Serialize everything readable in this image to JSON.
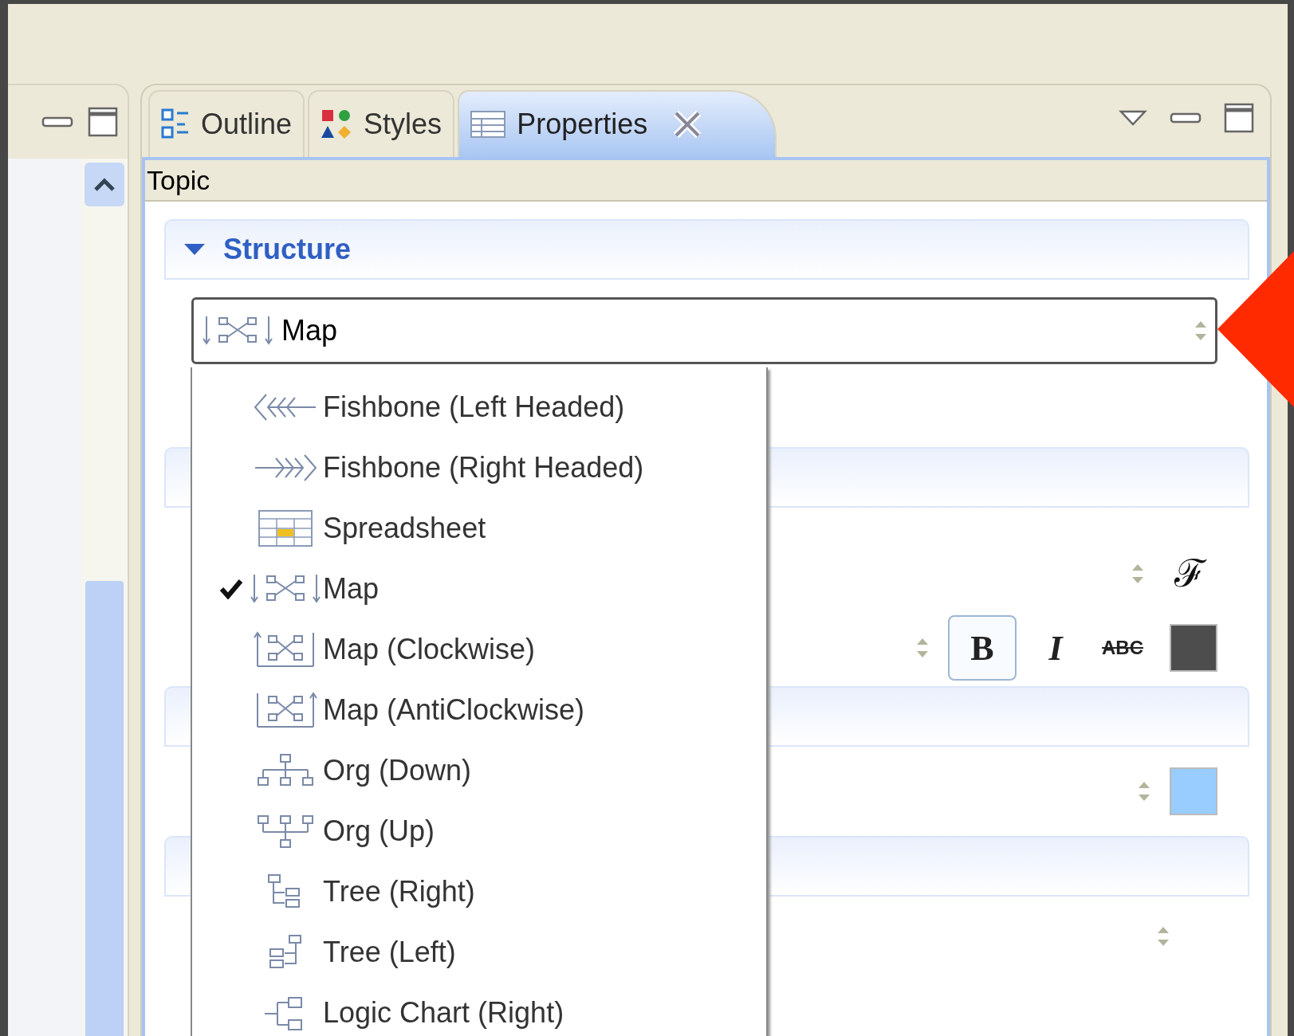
{
  "tabs": [
    {
      "label": "Outline",
      "kind": "outline",
      "selected": false
    },
    {
      "label": "Styles",
      "kind": "styles",
      "selected": false
    },
    {
      "label": "Properties",
      "kind": "properties",
      "selected": true
    }
  ],
  "panel_title": "Topic",
  "section": {
    "title": "Structure",
    "expanded": true
  },
  "combo": {
    "value": "Map",
    "kind": "map"
  },
  "dropdown": {
    "items": [
      {
        "label": "Fishbone (Left Headed)",
        "kind": "fishbone-left",
        "selected": false
      },
      {
        "label": "Fishbone (Right Headed)",
        "kind": "fishbone-right",
        "selected": false
      },
      {
        "label": "Spreadsheet",
        "kind": "spreadsheet",
        "selected": false
      },
      {
        "label": "Map",
        "kind": "map",
        "selected": true
      },
      {
        "label": "Map (Clockwise)",
        "kind": "map-cw",
        "selected": false
      },
      {
        "label": "Map (AntiClockwise)",
        "kind": "map-acw",
        "selected": false
      },
      {
        "label": "Org (Down)",
        "kind": "org-down",
        "selected": false
      },
      {
        "label": "Org (Up)",
        "kind": "org-up",
        "selected": false
      },
      {
        "label": "Tree (Right)",
        "kind": "tree-right",
        "selected": false
      },
      {
        "label": "Tree (Left)",
        "kind": "tree-left",
        "selected": false
      },
      {
        "label": "Logic Chart (Right)",
        "kind": "logic-right",
        "selected": false
      }
    ]
  },
  "font_button": "ℱ",
  "text_style_buttons": [
    {
      "label": "B",
      "kind": "bold",
      "selected": true
    },
    {
      "label": "I",
      "kind": "italic",
      "selected": false
    },
    {
      "label": "ABC",
      "kind": "strike",
      "selected": false
    }
  ],
  "text_color": {
    "color": "#4d4d4d"
  },
  "fill_color": {
    "color": "#99ccff"
  }
}
